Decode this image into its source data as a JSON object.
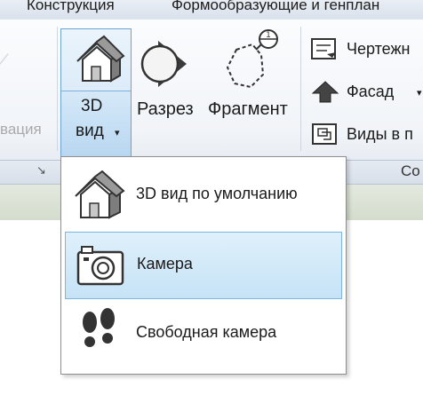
{
  "tabs": [
    "Конструкция",
    "Формообразующие и генплан"
  ],
  "left_panel": {
    "partial_label": "вация"
  },
  "view_button": {
    "line1": "3D",
    "line2": "вид",
    "arrow": "▾"
  },
  "buttons": {
    "section": "Разрез",
    "callout": "Фрагмент",
    "drafting": "Чертежн",
    "elevation": "Фасад",
    "plan_views": "Виды в п"
  },
  "panel": {
    "title_partial": "Со",
    "launcher": "↘"
  },
  "menu": {
    "items": [
      {
        "label": "3D вид по умолчанию",
        "icon": "house-3d-icon",
        "selected": false
      },
      {
        "label": "Камера",
        "icon": "camera-icon",
        "selected": true
      },
      {
        "label": "Свободная камера",
        "icon": "footprints-icon",
        "selected": false
      }
    ]
  },
  "colors": {
    "selection_bg": "#c6e3f6",
    "selection_border": "#7ab6e2"
  }
}
